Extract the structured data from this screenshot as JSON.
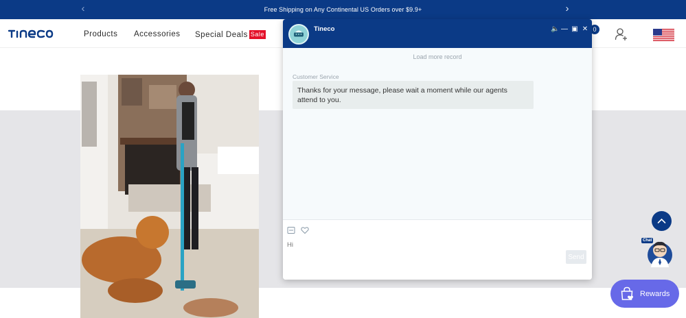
{
  "announcement": {
    "text": "Free Shipping on Any Continental US Orders over $9.9+"
  },
  "header": {
    "logo_text": "tineco",
    "nav": [
      {
        "label": "Products"
      },
      {
        "label": "Accessories"
      },
      {
        "label": "Special Deals"
      }
    ],
    "sale_badge": "Sale",
    "cart_count": "0"
  },
  "chat": {
    "title": "Tineco",
    "load_more": "Load more record",
    "agent_name": "Customer Service",
    "message": "Thanks for your message, please wait a moment while our agents attend to you.",
    "input_value": "Hi",
    "send_label": "Send"
  },
  "floating": {
    "chat_tag": "Chat",
    "rewards_label": "Rewards"
  },
  "colors": {
    "brand_navy": "#0b3a86",
    "sale_red": "#e4112a",
    "rewards_purple": "#6769e8",
    "band_gray": "#e5e5e8"
  },
  "icons": [
    "chevron-left-icon",
    "chevron-right-icon",
    "user-add-icon",
    "us-flag-icon",
    "sound-icon",
    "minimize-icon",
    "popout-icon",
    "close-icon",
    "mail-icon",
    "heart-icon",
    "arrow-up-icon",
    "shopping-bag-heart-icon"
  ]
}
